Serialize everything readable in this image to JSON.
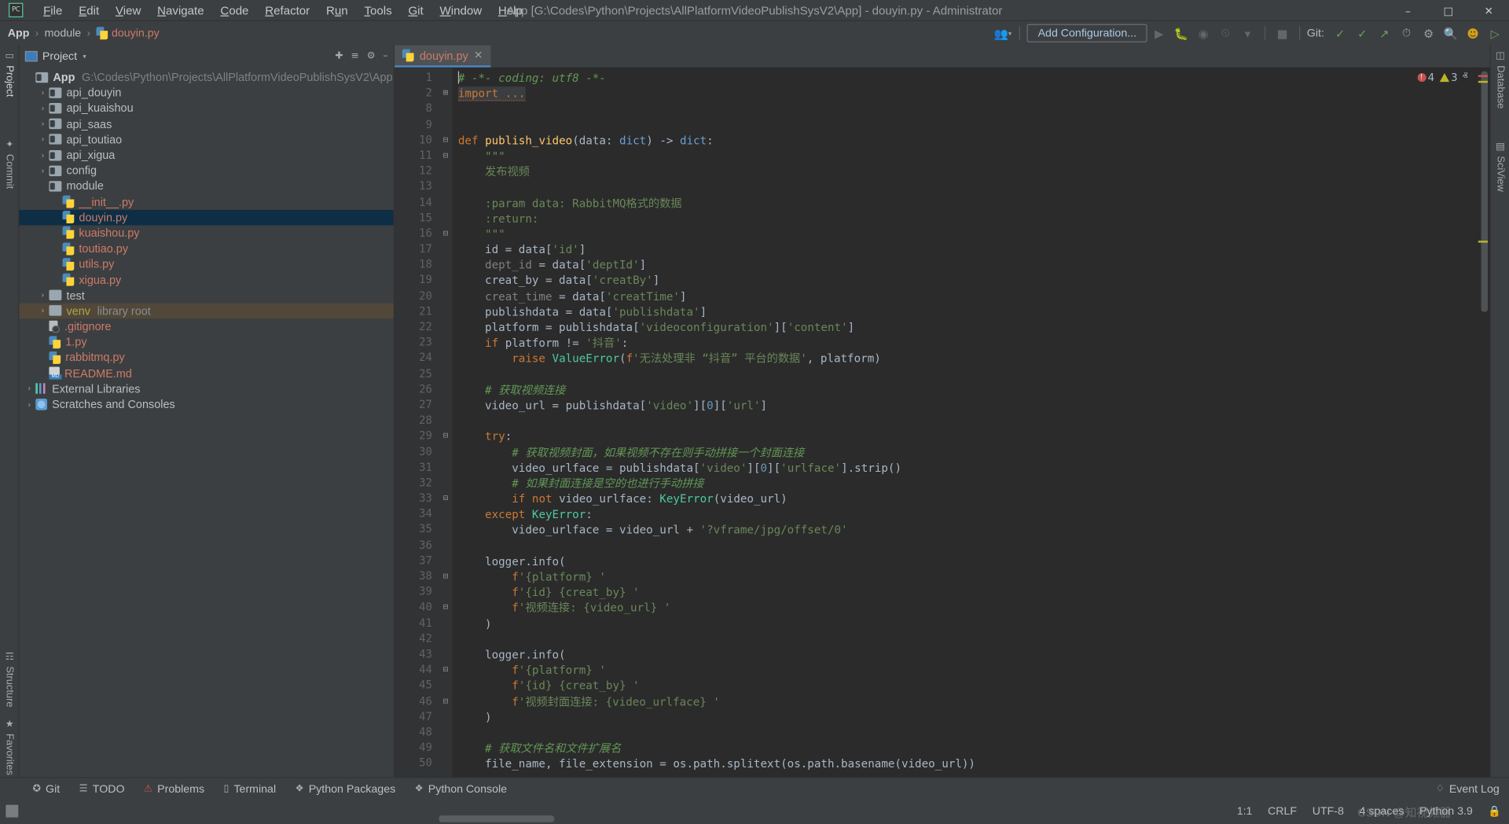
{
  "window": {
    "title": "App [G:\\Codes\\Python\\Projects\\AllPlatformVideoPublishSysV2\\App] - douyin.py - Administrator",
    "logo": "PC",
    "minimize": "–",
    "maximize": "□",
    "close": "✕"
  },
  "menubar": {
    "items": [
      {
        "pre": "",
        "u": "F",
        "post": "ile"
      },
      {
        "pre": "",
        "u": "E",
        "post": "dit"
      },
      {
        "pre": "",
        "u": "V",
        "post": "iew"
      },
      {
        "pre": "",
        "u": "N",
        "post": "avigate"
      },
      {
        "pre": "",
        "u": "C",
        "post": "ode"
      },
      {
        "pre": "",
        "u": "R",
        "post": "efactor"
      },
      {
        "pre": "R",
        "u": "u",
        "post": "n"
      },
      {
        "pre": "",
        "u": "T",
        "post": "ools"
      },
      {
        "pre": "",
        "u": "G",
        "post": "it"
      },
      {
        "pre": "",
        "u": "W",
        "post": "indow"
      },
      {
        "pre": "",
        "u": "H",
        "post": "elp"
      }
    ]
  },
  "breadcrumb": {
    "items": [
      "App",
      "module",
      "douyin.py"
    ],
    "separator": "›"
  },
  "toolbar": {
    "run_configuration": "Add Configuration...",
    "git_label": "Git:",
    "icons": [
      "user-group-icon",
      "run-icon",
      "debug-icon",
      "coverage-icon",
      "profile-icon",
      "chevron-down-icon",
      "stop-icon",
      "git-update-icon",
      "git-commit-icon",
      "git-push-icon",
      "history-icon",
      "search-icon",
      "avatar-icon",
      "layout-icon"
    ]
  },
  "left_strip": {
    "labels": [
      "Project",
      "Commit",
      "Structure",
      "Favorites"
    ]
  },
  "right_strip": {
    "labels": [
      "Database",
      "SciView"
    ]
  },
  "project_panel": {
    "title": "Project",
    "header_icons": [
      "target-icon",
      "collapse-all-icon",
      "settings-icon",
      "hide-icon"
    ],
    "tree": [
      {
        "indent": 1,
        "arrow": "ⱟ",
        "icon": "folder",
        "name": "App",
        "bold": true,
        "path": "G:\\Codes\\Python\\Projects\\AllPlatformVideoPublishSysV2\\App",
        "state": "normal"
      },
      {
        "indent": 2,
        "arrow": "›",
        "icon": "folder",
        "name": "api_douyin",
        "state": "normal"
      },
      {
        "indent": 2,
        "arrow": "›",
        "icon": "folder",
        "name": "api_kuaishou",
        "state": "normal"
      },
      {
        "indent": 2,
        "arrow": "›",
        "icon": "folder",
        "name": "api_saas",
        "state": "normal"
      },
      {
        "indent": 2,
        "arrow": "›",
        "icon": "folder",
        "name": "api_toutiao",
        "state": "normal"
      },
      {
        "indent": 2,
        "arrow": "›",
        "icon": "folder",
        "name": "api_xigua",
        "state": "normal"
      },
      {
        "indent": 2,
        "arrow": "›",
        "icon": "folder",
        "name": "config",
        "state": "normal"
      },
      {
        "indent": 2,
        "arrow": "ⱟ",
        "icon": "folder",
        "name": "module",
        "state": "normal"
      },
      {
        "indent": 3,
        "arrow": "",
        "icon": "python",
        "name": "__init__.py",
        "state": "normal"
      },
      {
        "indent": 3,
        "arrow": "",
        "icon": "python",
        "name": "douyin.py",
        "state": "selected"
      },
      {
        "indent": 3,
        "arrow": "",
        "icon": "python",
        "name": "kuaishou.py",
        "state": "normal"
      },
      {
        "indent": 3,
        "arrow": "",
        "icon": "python",
        "name": "toutiao.py",
        "state": "normal"
      },
      {
        "indent": 3,
        "arrow": "",
        "icon": "python",
        "name": "utils.py",
        "state": "normal"
      },
      {
        "indent": 3,
        "arrow": "",
        "icon": "python",
        "name": "xigua.py",
        "state": "normal"
      },
      {
        "indent": 2,
        "arrow": "›",
        "icon": "folder-plain",
        "name": "test",
        "state": "normal"
      },
      {
        "indent": 2,
        "arrow": "›",
        "icon": "folder-plain",
        "name": "venv",
        "tag": "library root",
        "state": "highlight",
        "venv": true
      },
      {
        "indent": 2,
        "arrow": "",
        "icon": "gitignore",
        "name": ".gitignore",
        "state": "normal"
      },
      {
        "indent": 2,
        "arrow": "",
        "icon": "python",
        "name": "1.py",
        "state": "normal"
      },
      {
        "indent": 2,
        "arrow": "",
        "icon": "python",
        "name": "rabbitmq.py",
        "state": "normal"
      },
      {
        "indent": 2,
        "arrow": "",
        "icon": "markdown",
        "name": "README.md",
        "state": "normal"
      },
      {
        "indent": 1,
        "arrow": "›",
        "icon": "library",
        "name": "External Libraries",
        "state": "normal"
      },
      {
        "indent": 1,
        "arrow": "›",
        "icon": "scratch",
        "name": "Scratches and Consoles",
        "state": "normal"
      }
    ]
  },
  "editor": {
    "tab": {
      "label": "douyin.py",
      "close": "✕"
    },
    "inspections": {
      "errors": "4",
      "warnings": "3",
      "error_icon": "!",
      "chevron_up": "ⱏ",
      "chevron_down": "ⱟ"
    },
    "first_line_number": 1,
    "lines": [
      {
        "n": 1,
        "fold": "",
        "text": "# -*- coding: utf8 -*-",
        "kind": "comment-head"
      },
      {
        "n": 2,
        "fold": "⊞",
        "text": "import ...",
        "kind": "import-fold"
      },
      {
        "n": 8,
        "fold": "",
        "text": "",
        "kind": "blank"
      },
      {
        "n": 9,
        "fold": "",
        "text": "",
        "kind": "blank"
      },
      {
        "n": 10,
        "fold": "⊟",
        "text": "def publish_video(data: dict) -> dict:",
        "kind": "def"
      },
      {
        "n": 11,
        "fold": "⊟",
        "text": "    \"\"\"",
        "kind": "docstring"
      },
      {
        "n": 12,
        "fold": "",
        "text": "    发布视频",
        "kind": "docstring"
      },
      {
        "n": 13,
        "fold": "",
        "text": "",
        "kind": "blank"
      },
      {
        "n": 14,
        "fold": "",
        "text": "    :param data: RabbitMQ格式的数据",
        "kind": "docstring"
      },
      {
        "n": 15,
        "fold": "",
        "text": "    :return:",
        "kind": "docstring"
      },
      {
        "n": 16,
        "fold": "⊟",
        "text": "    \"\"\"",
        "kind": "docstring"
      },
      {
        "n": 17,
        "fold": "",
        "text": "    id = data['id']",
        "kind": "assign-id"
      },
      {
        "n": 18,
        "fold": "",
        "text": "    dept_id = data['deptId']",
        "kind": "assign-unused"
      },
      {
        "n": 19,
        "fold": "",
        "text": "    creat_by = data['creatBy']",
        "kind": "assign"
      },
      {
        "n": 20,
        "fold": "",
        "text": "    creat_time = data['creatTime']",
        "kind": "assign-unused"
      },
      {
        "n": 21,
        "fold": "",
        "text": "    publishdata = data['publishdata']",
        "kind": "assign"
      },
      {
        "n": 22,
        "fold": "",
        "text": "    platform = publishdata['videoconfiguration']['content']",
        "kind": "assign"
      },
      {
        "n": 23,
        "fold": "",
        "text": "    if platform != '抖音':",
        "kind": "if"
      },
      {
        "n": 24,
        "fold": "",
        "text": "        raise ValueError(f'无法处理非 “抖音” 平台的数据', platform)",
        "kind": "raise"
      },
      {
        "n": 25,
        "fold": "",
        "text": "",
        "kind": "blank"
      },
      {
        "n": 26,
        "fold": "",
        "text": "    # 获取视频连接",
        "kind": "comment"
      },
      {
        "n": 27,
        "fold": "",
        "text": "    video_url = publishdata['video'][0]['url']",
        "kind": "assign"
      },
      {
        "n": 28,
        "fold": "",
        "text": "",
        "kind": "blank"
      },
      {
        "n": 29,
        "fold": "⊟",
        "text": "    try:",
        "kind": "try"
      },
      {
        "n": 30,
        "fold": "",
        "text": "        # 获取视频封面，如果视频不存在则手动拼接一个封面连接",
        "kind": "comment"
      },
      {
        "n": 31,
        "fold": "",
        "text": "        video_urlface = publishdata['video'][0]['urlface'].strip()",
        "kind": "assign"
      },
      {
        "n": 32,
        "fold": "",
        "text": "        # 如果封面连接是空的也进行手动拼接",
        "kind": "comment"
      },
      {
        "n": 33,
        "fold": "⊟",
        "text": "        if not video_urlface: KeyError(video_url)",
        "kind": "if-keyerror"
      },
      {
        "n": 34,
        "fold": "",
        "text": "    except KeyError:",
        "kind": "except"
      },
      {
        "n": 35,
        "fold": "",
        "text": "        video_urlface = video_url + '?vframe/jpg/offset/0'",
        "kind": "assign-str"
      },
      {
        "n": 36,
        "fold": "",
        "text": "",
        "kind": "blank"
      },
      {
        "n": 37,
        "fold": "",
        "text": "    logger.info(",
        "kind": "call"
      },
      {
        "n": 38,
        "fold": "⊟",
        "text": "        f'{platform} '",
        "kind": "fstring"
      },
      {
        "n": 39,
        "fold": "",
        "text": "        f'{id} {creat_by} '",
        "kind": "fstring"
      },
      {
        "n": 40,
        "fold": "⊟",
        "text": "        f'视频连接: {video_url} '",
        "kind": "fstring"
      },
      {
        "n": 41,
        "fold": "",
        "text": "    )",
        "kind": "call"
      },
      {
        "n": 42,
        "fold": "",
        "text": "",
        "kind": "blank"
      },
      {
        "n": 43,
        "fold": "",
        "text": "    logger.info(",
        "kind": "call"
      },
      {
        "n": 44,
        "fold": "⊟",
        "text": "        f'{platform} '",
        "kind": "fstring"
      },
      {
        "n": 45,
        "fold": "",
        "text": "        f'{id} {creat_by} '",
        "kind": "fstring"
      },
      {
        "n": 46,
        "fold": "⊟",
        "text": "        f'视频封面连接: {video_urlface} '",
        "kind": "fstring"
      },
      {
        "n": 47,
        "fold": "",
        "text": "    )",
        "kind": "call"
      },
      {
        "n": 48,
        "fold": "",
        "text": "",
        "kind": "blank"
      },
      {
        "n": 49,
        "fold": "",
        "text": "    # 获取文件名和文件扩展名",
        "kind": "comment"
      },
      {
        "n": 50,
        "fold": "",
        "text": "    file_name, file_extension = os.path.splitext(os.path.basename(video_url))",
        "kind": "assign"
      }
    ]
  },
  "bottom_bar": {
    "items": [
      {
        "icon": "git-branch-icon",
        "label": "Git"
      },
      {
        "icon": "todo-icon",
        "label": "TODO"
      },
      {
        "icon": "problems-icon",
        "label": "Problems"
      },
      {
        "icon": "terminal-icon",
        "label": "Terminal"
      },
      {
        "icon": "python-packages-icon",
        "label": "Python Packages"
      },
      {
        "icon": "python-console-icon",
        "label": "Python Console"
      }
    ],
    "event_log": {
      "icon": "bell-icon",
      "label": "Event Log"
    }
  },
  "status_bar": {
    "caret_position": "1:1",
    "line_separator": "CRLF",
    "encoding": "UTF-8",
    "indent": "4 spaces",
    "interpreter": "Python 3.9",
    "lock_icon": "🔒",
    "watermark": "CSDN @知视频器"
  }
}
